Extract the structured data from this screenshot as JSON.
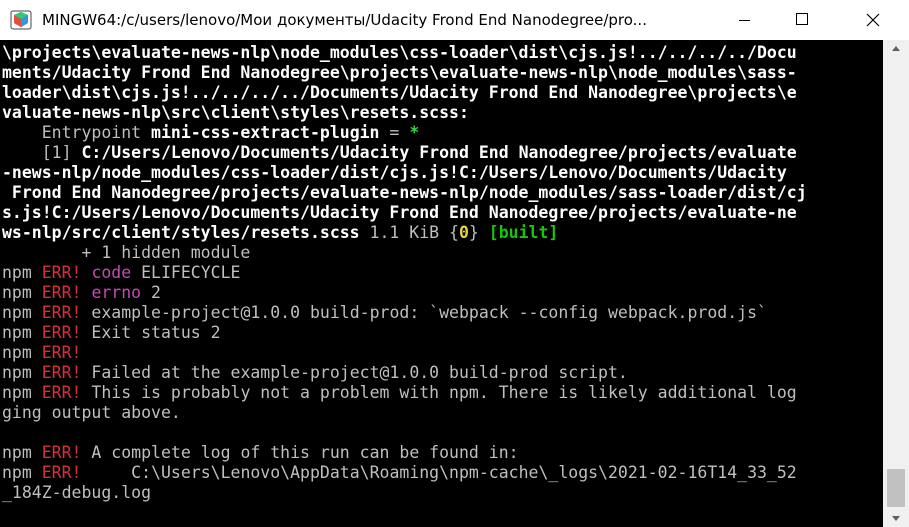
{
  "window": {
    "title": "MINGW64:/c/users/lenovo/Мои документы/Udacity Frond End Nanodegree/pro..."
  },
  "icons": [
    "mingw-terminal-icon",
    "minimize-icon",
    "maximize-icon",
    "close-icon"
  ],
  "colors": {
    "background": "#000000",
    "error_red": "#d6313a",
    "magenta": "#c64ab3",
    "green": "#16c60c",
    "yellow": "#e6d244"
  },
  "terminal": {
    "l1": "\\projects\\evaluate-news-nlp\\node_modules\\css-loader\\dist\\cjs.js!../../../../Docu",
    "l2": "ments/Udacity Frond End Nanodegree\\projects\\evaluate-news-nlp\\node_modules\\sass-",
    "l3": "loader\\dist\\cjs.js!../../../../Documents/Udacity Frond End Nanodegree\\projects\\e",
    "l4": "valuate-news-nlp\\src\\client\\styles\\resets.scss:",
    "l5a": "    Entrypoint ",
    "l5b": "mini-css-extract-plugin",
    "l5c": " = ",
    "l5d": "*",
    "l6a": "    [1] ",
    "l6b": "C:/Users/Lenovo/Documents/Udacity Frond End Nanodegree/projects/evaluate",
    "l7": "-news-nlp/node_modules/css-loader/dist/cjs.js!C:/Users/Lenovo/Documents/Udacity",
    "l8": " Frond End Nanodegree/projects/evaluate-news-nlp/node_modules/sass-loader/dist/cj",
    "l9": "s.js!C:/Users/Lenovo/Documents/Udacity Frond End Nanodegree/projects/evaluate-ne",
    "l10a": "ws-nlp/src/client/styles/resets.scss",
    "l10b": " 1.1 KiB {",
    "l10c": "0",
    "l10d": "} ",
    "l10e": "[built]",
    "l11": "        + 1 hidden module",
    "npm": "npm ",
    "err": "ERR!",
    "l12a": "code",
    "l12b": " ELIFECYCLE",
    "l13a": "errno",
    "l13b": " 2",
    "l14": " example-project@1.0.0 build-prod: `webpack --config webpack.prod.js`",
    "l15": " Exit status 2",
    "l17": " Failed at the example-project@1.0.0 build-prod script.",
    "l18": " This is probably not a problem with npm. There is likely additional log",
    "l19": "ging output above.",
    "l21": " A complete log of this run can be found in:",
    "l22": "     C:\\Users\\Lenovo\\AppData\\Roaming\\npm-cache\\_logs\\2021-02-16T14_33_52",
    "l23": "_184Z-debug.log"
  }
}
